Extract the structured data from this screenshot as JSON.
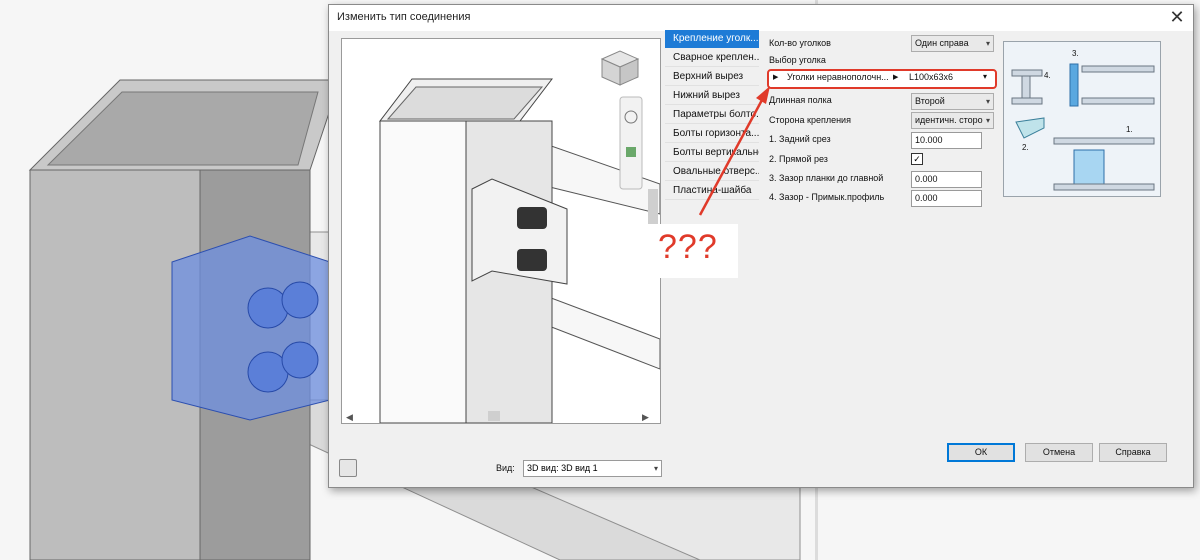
{
  "dialog": {
    "title": "Изменить тип соединения"
  },
  "tabs": [
    "Крепление уголк...",
    "Сварное креплен...",
    "Верхний вырез",
    "Нижний вырез",
    "Параметры болто...",
    "Болты горизонта...",
    "Болты вертикально",
    "Овальные отверс...",
    "Пластина-шайба"
  ],
  "props": {
    "angle_count_label": "Кол-во уголков",
    "angle_count_value": "Один справа",
    "angle_select_label": "Выбор уголка",
    "angle_family": "Уголки неравнополочн...",
    "angle_size": "L100x63x6",
    "long_leg_label": "Длинная полка",
    "long_leg_value": "Второй",
    "side_label": "Сторона крепления",
    "side_value": "идентичн. сторо",
    "rear_cut_label": "1. Задний срез",
    "rear_cut_value": "10.000",
    "straight_cut_label": "2. Прямой рез",
    "straight_cut_checked": "✓",
    "plate_gap_label": "3. Зазор планки до главной",
    "plate_gap_value": "0.000",
    "profile_gap_label": "4. Зазор - Примык.профиль",
    "profile_gap_value": "0.000"
  },
  "diagram_labels": {
    "l3": "3.",
    "l4": "4.",
    "l2": "2.",
    "l1": "1."
  },
  "view": {
    "label": "Вид:",
    "value": "3D вид: 3D вид 1"
  },
  "buttons": {
    "ok": "ОК",
    "cancel": "Отмена",
    "help": "Справка"
  },
  "annotation": {
    "text": "???",
    "color": "#e03a2a"
  },
  "colors": {
    "accent": "#1e7bd6",
    "annotation": "#e03a2a"
  }
}
